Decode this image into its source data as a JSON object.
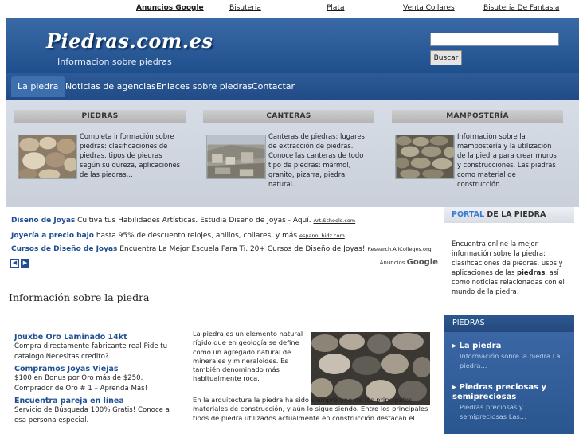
{
  "top_links": {
    "google_label": "Anuncios Google",
    "links": [
      "Bisuteria",
      "Plata",
      "Venta Collares",
      "Bisuteria De Fantasia"
    ]
  },
  "header": {
    "logo": "Piedras.com.es",
    "tagline": "Informacion sobre piedras",
    "search_placeholder": "",
    "search_button": "Buscar"
  },
  "nav": [
    "La piedra",
    "Noticias de agencias",
    "Enlaces sobre piedras",
    "Contactar"
  ],
  "features": [
    {
      "title": "PIEDRAS",
      "text": "Completa información sobre piedras: clasificaciones de piedras, tipos de piedras según su dureza, aplicaciones de las piedras..."
    },
    {
      "title": "CANTERAS",
      "text": "Canteras de piedras: lugares de extracción de piedras. Conoce las canteras de todo tipo de piedras: mármol, granito, pizarra, piedra natural..."
    },
    {
      "title": "MAMPOSTERÍA",
      "text": "Información sobre la mampostería y la utilización de la piedra para crear muros y construcciones. Las piedras como material de construcción."
    }
  ],
  "ads": [
    {
      "title": "Diseño de Joyas",
      "text": "Cultiva tus Habilidades Artísticas. Estudia Diseño de Joyas - Aquí.",
      "url": "Art.Schools.com"
    },
    {
      "title": "Joyería a precio bajo",
      "text": "hasta 95% de descuento relojes, anillos, collares, y más",
      "url": "espanol.bidz.com"
    },
    {
      "title": "Cursos de Diseño de Joyas",
      "text": "Encuentra La Mejor Escuela Para Ti. 20+ Cursos de Diseño de Joyas!",
      "url": "Research.AllColleges.org"
    }
  ],
  "ads_by": "Anuncios",
  "ads_brand": "Google",
  "main_title": "Información sobre la piedra",
  "left_ads": [
    {
      "title": "Jouxbe Oro Laminado 14kt",
      "text": "Compra directamente fabricante real Pide tu catalogo.Necesitas credito?"
    },
    {
      "title": "Compramos Joyas Viejas",
      "text": "$100 en Bonus por Oro más de $250. Comprador de Oro # 1 – Aprenda Más!"
    },
    {
      "title": "Encuentra pareja en línea",
      "text": "Servicio de Búsqueda 100% Gratis! Conoce a esa persona especial."
    }
  ],
  "article": {
    "p1": "La piedra es un elemento natural rígido que en geología se define como un agregado natural de minerales y mineraloides. Es también denominado más habitualmente roca.",
    "p2": "En la arquitectura la piedra ha sido siempre uno de los principales materiales de construcción, y aún lo sigue siendo. Entre los principales tipos de piedra utilizados actualmente en construcción destacan el"
  },
  "sidebar": {
    "portal_word": "PORTAL",
    "portal_rest": "DE LA PIEDRA",
    "intro_a": "Encuentra online la mejor información sobre la piedra: clasificaciones de piedras, usos y aplicaciones de las ",
    "intro_bold": "piedras",
    "intro_b": ", así como noticias relacionadas con el mundo de la piedra.",
    "section_title": "PIEDRAS",
    "items": [
      {
        "title": "La piedra",
        "sub": "Información sobre la piedra   La piedra..."
      },
      {
        "title": "Piedras preciosas y semipreciosas",
        "sub": "Piedras preciosas y semipreciosas   Las..."
      }
    ]
  }
}
